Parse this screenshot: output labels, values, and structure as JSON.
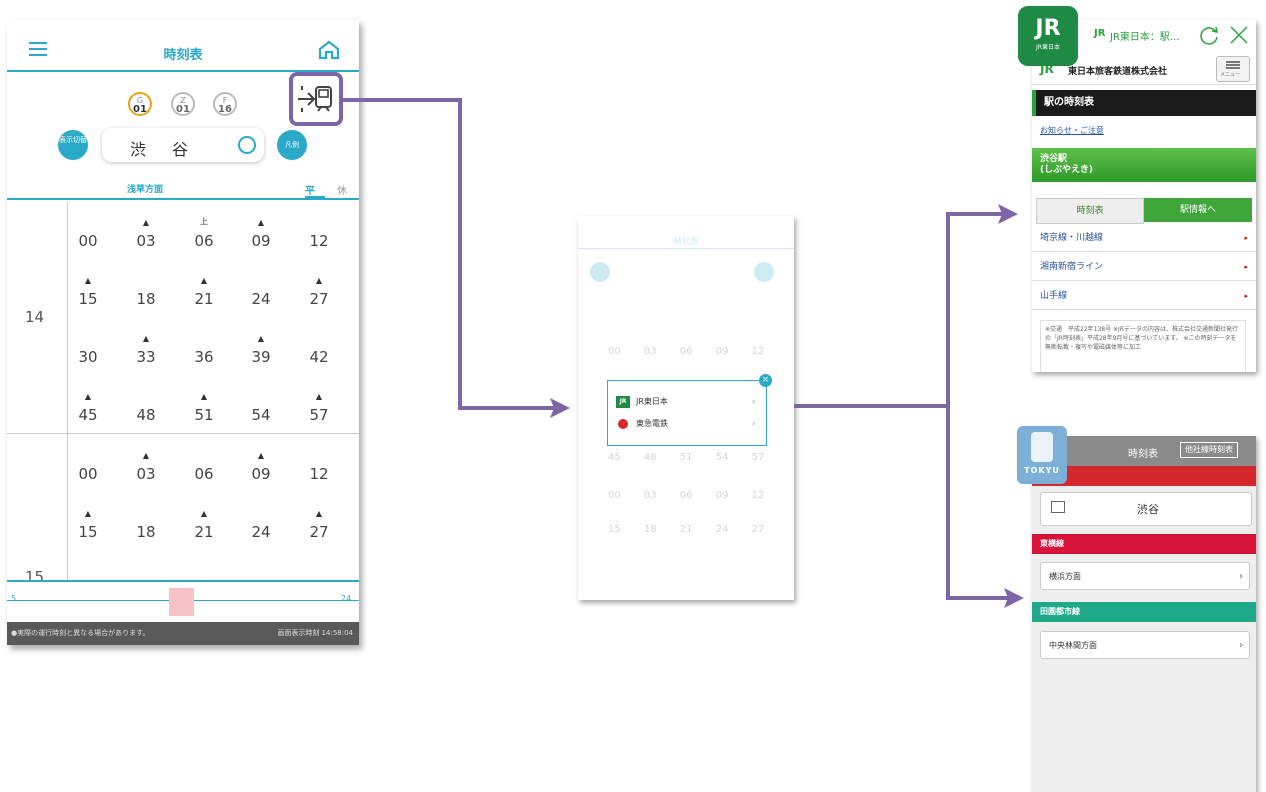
{
  "p1": {
    "title": "時刻表",
    "lines": [
      {
        "letter": "G",
        "num": "01"
      },
      {
        "letter": "Z",
        "num": "01"
      },
      {
        "letter": "F",
        "num": "16"
      }
    ],
    "display_toggle": "表示切替",
    "station": "渋谷",
    "legend": "凡例",
    "direction": "浅草方面",
    "tab_weekday": "平",
    "tab_holiday": "休",
    "hours": [
      "14",
      "15"
    ],
    "h14_rows": [
      [
        "00",
        "03",
        "06",
        "09",
        "12"
      ],
      [
        "15",
        "18",
        "21",
        "24",
        "27"
      ],
      [
        "30",
        "33",
        "36",
        "39",
        "42"
      ],
      [
        "45",
        "48",
        "51",
        "54",
        "57"
      ]
    ],
    "h15_rows": [
      [
        "00",
        "03",
        "06",
        "09",
        "12"
      ],
      [
        "15",
        "18",
        "21",
        "24",
        "27"
      ]
    ],
    "kami_mark": "上",
    "slider_min": "5",
    "slider_max": "24",
    "footer_left": "●実際の運行時刻と異なる場合があります。",
    "footer_right": "画面表示時刻 14:58:04"
  },
  "p2": {
    "operators": [
      {
        "logo": "JR",
        "name": "JR東日本"
      },
      {
        "logo": "tokyu",
        "name": "東急電鉄"
      }
    ]
  },
  "p3": {
    "logo": "JR",
    "logo_sub": "JR東日本",
    "browser_title": "JR東日本：駅...",
    "company": "東日本旅客鉄道株式会社",
    "menu": "メニュー",
    "section": "駅の時刻表",
    "notice": "お知らせ・ご注意",
    "station": "渋谷駅",
    "station_kana": "(しぶやえき)",
    "tab_timetable": "時刻表",
    "tab_info": "駅情報へ",
    "lines": [
      "埼京線・川越線",
      "湘南新宿ライン",
      "山手線"
    ],
    "note": "※交通　平成22年138号 ※JRデータの内容は、株式会社交通新聞社発行の「JR時刻表」平成28年9月号に基づいています。 ※この時刻データを無断転載・複写や電磁媒体等に加工"
  },
  "p4": {
    "logo": "TOKYU",
    "title": "時刻表",
    "other_button": "他社線時刻表",
    "station": "渋谷",
    "sections": [
      {
        "name": "東横線",
        "color": "#d9143a",
        "dest": "横浜方面"
      },
      {
        "name": "田園都市線",
        "color": "#20a88a",
        "dest": "中央林間方面"
      }
    ]
  },
  "colors": {
    "accent": "#2aa9c8",
    "highlight": "#8064a8",
    "jr_green": "#1e8a43",
    "tokyu_red": "#d4282c"
  }
}
